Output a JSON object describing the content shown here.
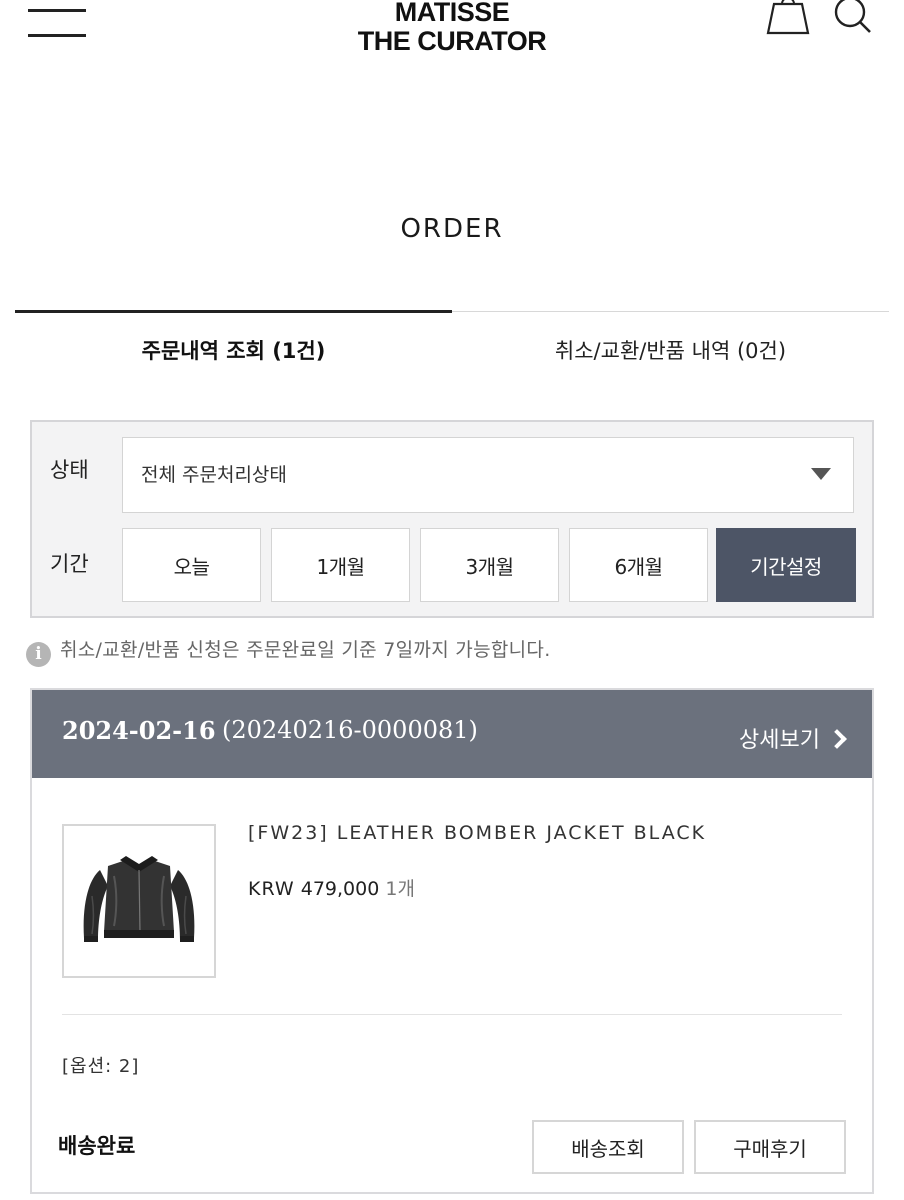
{
  "header": {
    "logo_line1": "MATISSE",
    "logo_line2": "THE CURATOR",
    "menu_icon": "menu-icon",
    "cart_icon": "shopping-bag-icon",
    "search_icon": "search-icon"
  },
  "page_title": "ORDER",
  "tabs": [
    {
      "label": "주문내역 조회 (1건)",
      "active": true
    },
    {
      "label": "취소/교환/반품 내역 (0건)",
      "active": false
    }
  ],
  "filter": {
    "status_label": "상태",
    "status_value": "전체 주문처리상태",
    "period_label": "기간",
    "periods": [
      "오늘",
      "1개월",
      "3개월",
      "6개월",
      "기간설정"
    ],
    "active_period": "기간설정"
  },
  "notice": "취소/교환/반품 신청은 주문완료일 기준 7일까지 가능합니다.",
  "order": {
    "date": "2024-02-16",
    "order_no": "(20240216-0000081)",
    "detail_label": "상세보기",
    "product": {
      "name": "[FW23] LEATHER BOMBER JACKET BLACK",
      "currency": "KRW",
      "price": "479,000",
      "quantity": "1개",
      "option": "[옵션: 2]"
    },
    "shipping_status": "배송완료",
    "actions": [
      "배송조회",
      "구매후기"
    ]
  },
  "colors": {
    "accent_dark": "#4d5566",
    "order_header": "#6b717d",
    "filter_bg": "#f3f3f4"
  }
}
